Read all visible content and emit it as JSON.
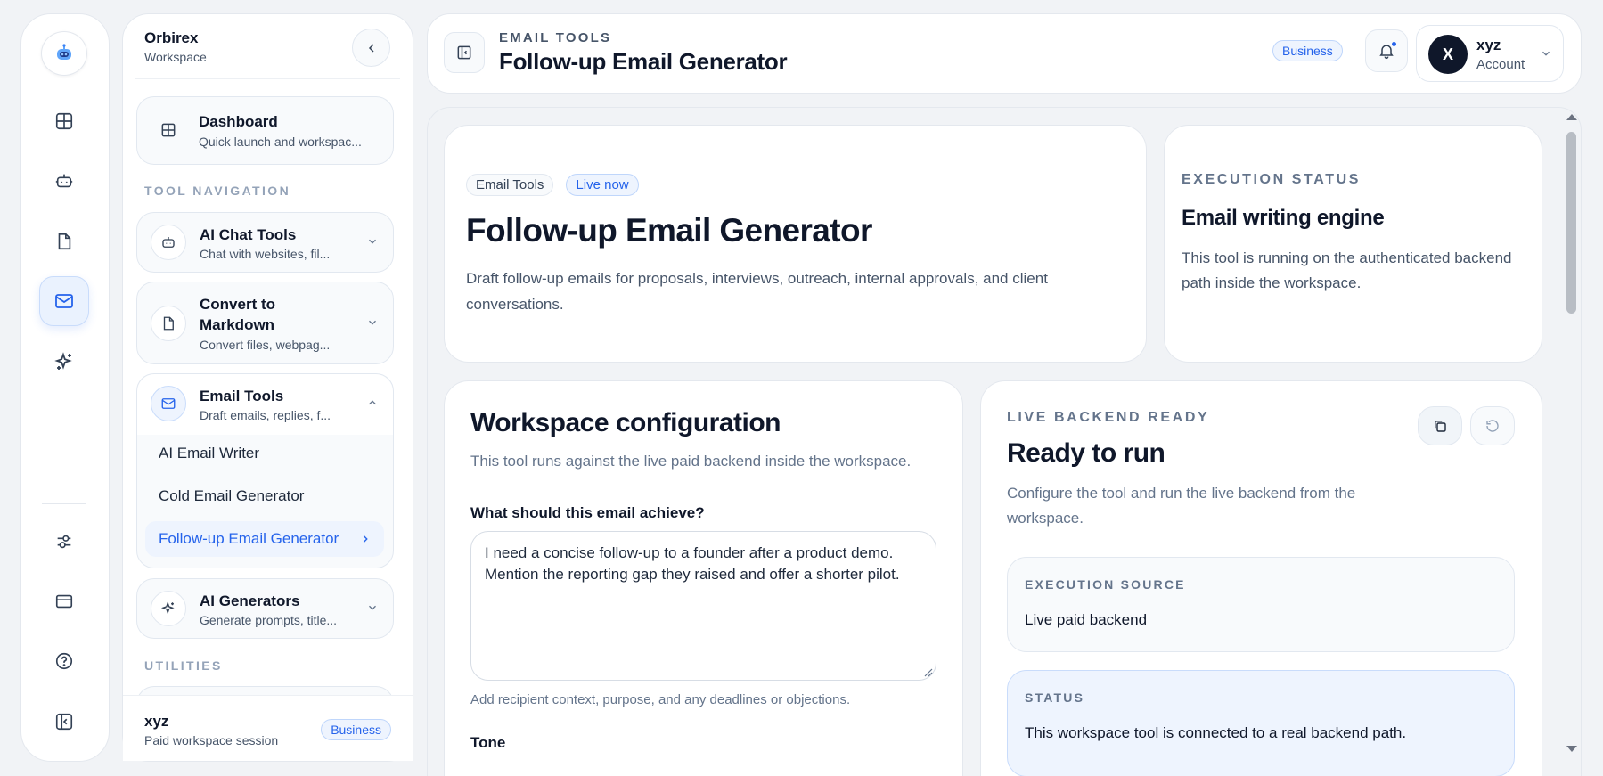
{
  "rail": {
    "items": [
      "dashboard",
      "ai-chat",
      "convert",
      "email",
      "ai-generators",
      "settings",
      "billing",
      "help",
      "toggle-sidebar"
    ]
  },
  "sidebar": {
    "workspace_name": "Orbirex",
    "workspace_sub": "Workspace",
    "dashboard": {
      "title": "Dashboard",
      "sub": "Quick launch and workspac..."
    },
    "tool_navigation_label": "TOOL NAVIGATION",
    "groups": [
      {
        "title": "AI Chat Tools",
        "sub": "Chat with websites, fil..."
      },
      {
        "title": "Convert to Markdown",
        "title_line1": "Convert to",
        "title_line2": "Markdown",
        "sub": "Convert files, webpag..."
      },
      {
        "title": "Email Tools",
        "sub": "Draft emails, replies, f...",
        "items": [
          "AI Email Writer",
          "Cold Email Generator",
          "Follow-up Email Generator"
        ]
      },
      {
        "title": "AI Generators",
        "sub": "Generate prompts, title..."
      }
    ],
    "utilities_label": "UTILITIES",
    "footer": {
      "user": "xyz",
      "session": "Paid workspace session",
      "plan": "Business"
    }
  },
  "topbar": {
    "eyebrow": "EMAIL TOOLS",
    "title": "Follow-up Email Generator",
    "plan_badge": "Business",
    "account": {
      "initial": "X",
      "name": "xyz",
      "sub": "Account"
    }
  },
  "hero": {
    "chips": [
      "Email Tools",
      "Live now"
    ],
    "title": "Follow-up Email Generator",
    "description": "Draft follow-up emails for proposals, interviews, outreach, internal approvals, and client conversations."
  },
  "exec_status": {
    "eyebrow": "EXECUTION STATUS",
    "title": "Email writing engine",
    "description": "This tool is running on the authenticated backend path inside the workspace."
  },
  "config": {
    "title": "Workspace configuration",
    "subtitle": "This tool runs against the live paid backend inside the workspace.",
    "goal_label": "What should this email achieve?",
    "goal_value": "I need a concise follow-up to a founder after a product demo. Mention the reporting gap they raised and offer a shorter pilot.",
    "goal_hint": "Add recipient context, purpose, and any deadlines or objections.",
    "tone_label": "Tone"
  },
  "run": {
    "eyebrow": "LIVE BACKEND READY",
    "title": "Ready to run",
    "description": "Configure the tool and run the live backend from the workspace.",
    "source_label": "EXECUTION SOURCE",
    "source_value": "Live paid backend",
    "status_label": "STATUS",
    "status_value": "This workspace tool is connected to a real backend path."
  },
  "colors": {
    "accent": "#2563eb",
    "accent_soft": "#eef4fe",
    "ink": "#0f172a",
    "muted": "#475569",
    "page_bg": "#f1f3f6"
  }
}
